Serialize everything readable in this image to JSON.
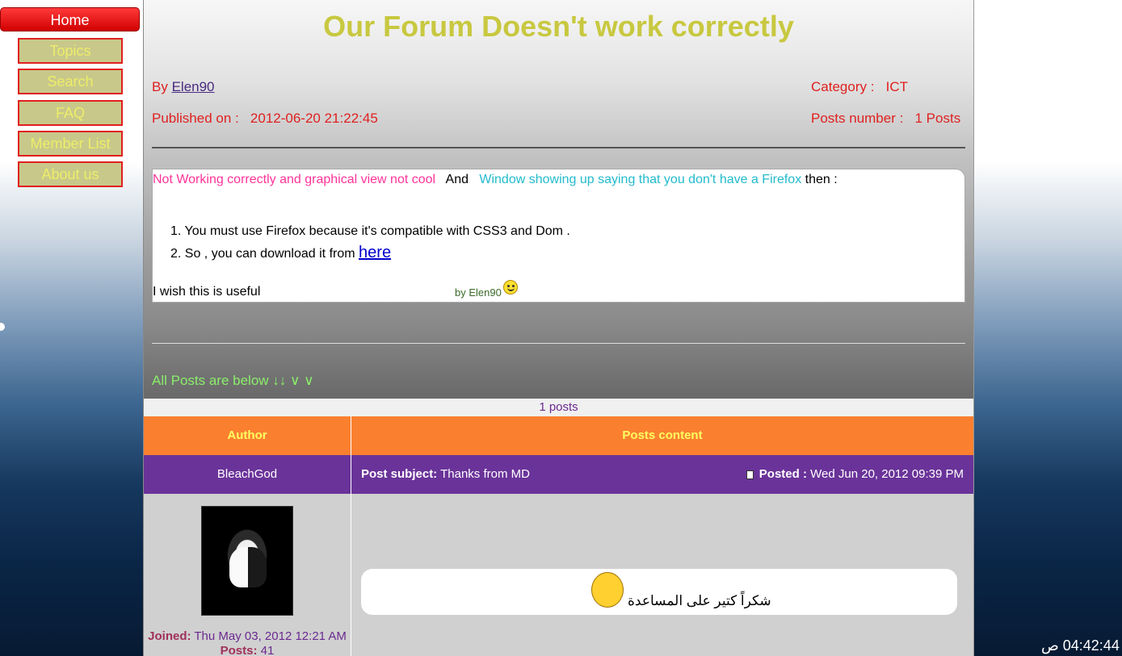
{
  "nav": {
    "home": "Home",
    "topics": "Topics",
    "search": "Search",
    "faq": "FAQ",
    "member_list": "Member List",
    "about_us": "About us"
  },
  "topic": {
    "title": "Our Forum Doesn't work correctly",
    "by_label": "By",
    "author": "Elen90",
    "published_label": "Published on :",
    "published_value": "2012-06-20 21:22:45",
    "category_label": "Category :",
    "category_value": "ICT",
    "posts_number_label": "Posts number :",
    "posts_number_value": "1 Posts"
  },
  "content": {
    "line1_pink": "Not Working correctly and graphical view not cool",
    "line1_and": "And",
    "line1_cyan": "Window showing up saying that you don't have a Firefox",
    "line1_then": "then :",
    "item1": "1.   You must use Firefox because it's compatible with CSS3 and Dom .",
    "item2_prefix": "2.  So , you can download it from",
    "item2_link": "here",
    "useful": "I wish this is useful",
    "byline": "by Elen90"
  },
  "all_posts_label": "All Posts are below ↓↓ ∨ ∨",
  "posts_table": {
    "count": "1   posts",
    "header_author": "Author",
    "header_content": "Posts content",
    "row_author": "BleachGod",
    "subject_label": "Post subject:",
    "subject_value": "Thanks from MD",
    "posted_label": "Posted :",
    "posted_value": "Wed Jun 20, 2012 09:39 PM",
    "joined_label": "Joined:",
    "joined_value": "Thu May 03, 2012 12:21 AM",
    "posts_label": "Posts:",
    "posts_value": "41",
    "message": "شكراً كتير على المساعدة"
  },
  "clock": "04:42:44 ص",
  "colors": {
    "title": "#c8c840",
    "meta": "#e02020",
    "table_header": "#fa8030",
    "table_row": "#6a3399",
    "home_button": "#e01010"
  },
  "icons": [
    "smiley-icon",
    "crying-emoji-icon",
    "post-indicator-icon",
    "avatar-image"
  ]
}
